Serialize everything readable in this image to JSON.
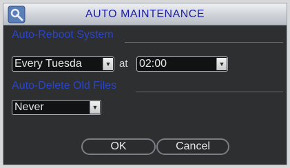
{
  "dialog": {
    "title": "AUTO MAINTENANCE",
    "icon": "settings-wrench-icon"
  },
  "reboot": {
    "section_label": "Auto-Reboot System",
    "day_value": "Every Tuesda",
    "at_label": "at",
    "time_value": "02:00"
  },
  "delete": {
    "section_label": "Auto-Delete Old Files",
    "value": "Never"
  },
  "buttons": {
    "ok_label": "OK",
    "cancel_label": "Cancel"
  },
  "colors": {
    "section_accent": "#2a45c9",
    "title_text": "#1c1ea8",
    "panel_bg": "#2d2f31"
  }
}
